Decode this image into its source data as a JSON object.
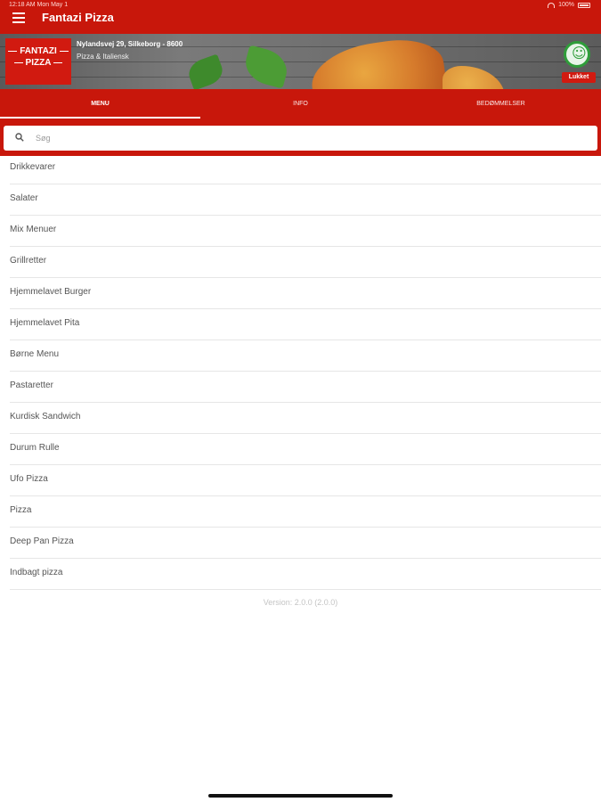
{
  "status_bar": {
    "time": "12:18 AM   Mon May 1",
    "battery": "100%"
  },
  "app_bar": {
    "title": "Fantazi Pizza"
  },
  "banner": {
    "logo_line1": "FANTAZI",
    "logo_line2": "PIZZA",
    "address": "Nylandsvej 29, Silkeborg - 8600",
    "cuisine": "Pizza & Italiensk",
    "status": "Lukket"
  },
  "tabs": [
    {
      "label": "MENU"
    },
    {
      "label": "INFO"
    },
    {
      "label": "BEDØMMELSER"
    }
  ],
  "search": {
    "placeholder": "Søg",
    "value": ""
  },
  "menu_items": [
    {
      "label": "Drikkevarer"
    },
    {
      "label": "Salater"
    },
    {
      "label": "Mix Menuer"
    },
    {
      "label": "Grillretter"
    },
    {
      "label": "Hjemmelavet Burger"
    },
    {
      "label": "Hjemmelavet Pita"
    },
    {
      "label": "Børne Menu"
    },
    {
      "label": "Pastaretter"
    },
    {
      "label": "Kurdisk Sandwich"
    },
    {
      "label": "Durum Rulle"
    },
    {
      "label": "Ufo Pizza"
    },
    {
      "label": "Pizza"
    },
    {
      "label": "Deep Pan Pizza"
    },
    {
      "label": "Indbagt pizza"
    }
  ],
  "footer": {
    "version": "Version: 2.0.0 (2.0.0)"
  },
  "colors": {
    "brand_red": "#c8170b",
    "open_green": "#2f9d3a"
  },
  "icons": [
    "menu-icon",
    "search-icon",
    "wifi-icon",
    "battery-icon",
    "smiley-badge-icon"
  ]
}
